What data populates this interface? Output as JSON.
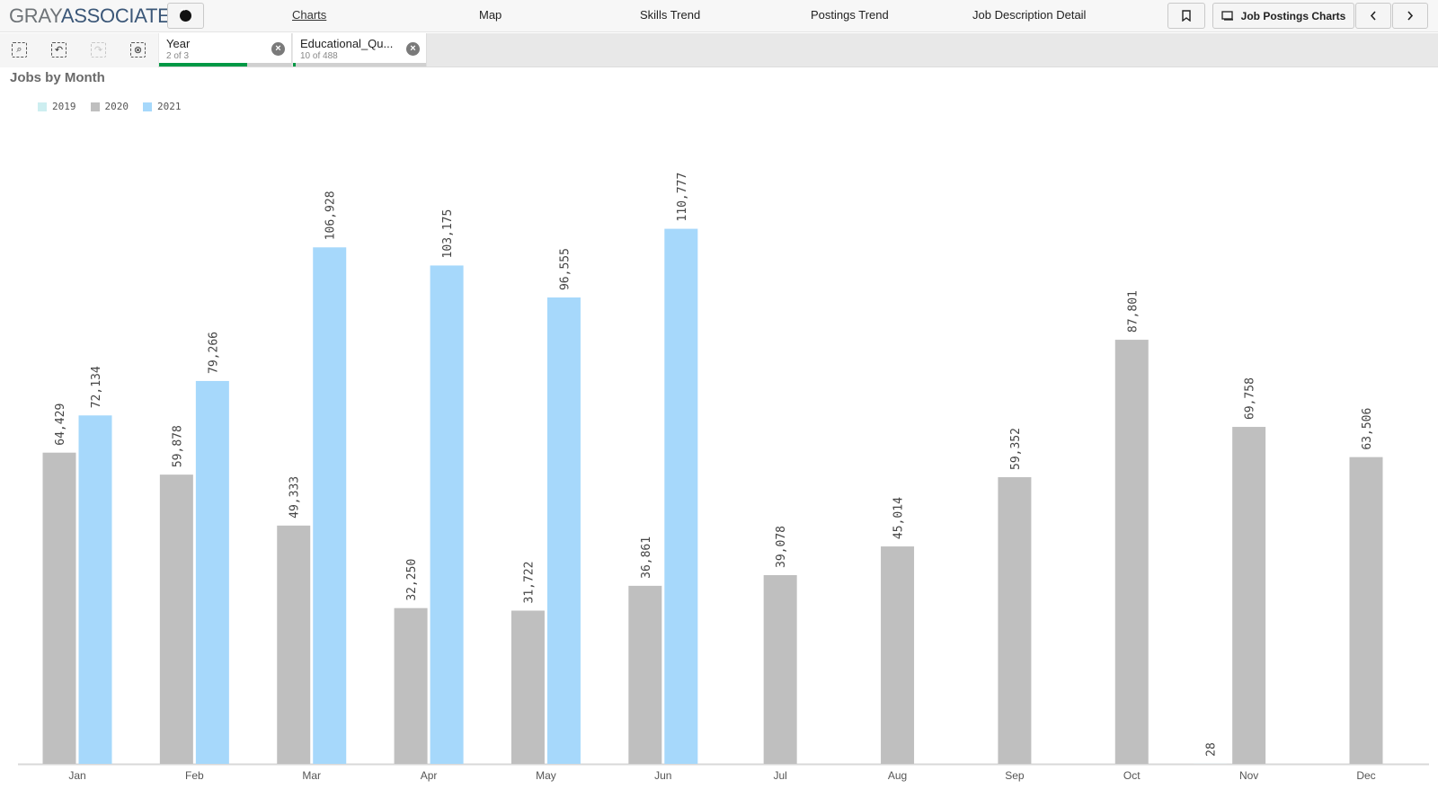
{
  "header": {
    "logo_part1": "GRAY",
    "logo_part2": "ASSOCIATES",
    "nav": [
      {
        "label": "Charts",
        "active": true
      },
      {
        "label": "Map",
        "active": false
      },
      {
        "label": "Skills Trend",
        "active": false
      },
      {
        "label": "Postings Trend",
        "active": false
      },
      {
        "label": "Job Description Detail",
        "active": false
      }
    ],
    "sheet_button_label": "Job Postings Charts",
    "icons": {
      "menu": "more-icon",
      "bookmark": "bookmark-icon",
      "sheet": "sheet-icon",
      "prev": "chevron-left-icon",
      "next": "chevron-right-icon"
    }
  },
  "selections": {
    "tools": [
      "smart-search-icon",
      "step-back-icon",
      "step-forward-icon",
      "clear-all-icon"
    ],
    "filters": [
      {
        "title": "Year",
        "subtitle": "2 of 3",
        "progress": 0.667
      },
      {
        "title": "Educational_Qu...",
        "subtitle": "10 of 488",
        "progress": 0.02
      }
    ]
  },
  "chart_data": {
    "type": "bar",
    "title": "Jobs by Month",
    "xlabel": "",
    "ylabel": "",
    "ylim": [
      0,
      120000
    ],
    "grid": false,
    "legend_position": "top-left",
    "categories": [
      "Jan",
      "Feb",
      "Mar",
      "Apr",
      "May",
      "Jun",
      "Jul",
      "Aug",
      "Sep",
      "Oct",
      "Nov",
      "Dec"
    ],
    "series": [
      {
        "name": "2019",
        "color": "#cdeef0",
        "values": [
          null,
          null,
          null,
          null,
          null,
          null,
          null,
          null,
          null,
          null,
          28,
          null
        ],
        "labels": [
          "",
          "",
          "",
          "",
          "",
          "",
          "",
          "",
          "",
          "",
          "28",
          ""
        ]
      },
      {
        "name": "2020",
        "color": "#bfbfbf",
        "values": [
          64429,
          59878,
          49333,
          32250,
          31722,
          36861,
          39078,
          45014,
          59352,
          87801,
          69758,
          63506
        ],
        "labels": [
          "64,429",
          "59,878",
          "49,333",
          "32,250",
          "31,722",
          "36,861",
          "39,078",
          "45,014",
          "59,352",
          "87,801",
          "69,758",
          "63,506"
        ]
      },
      {
        "name": "2021",
        "color": "#a6d8fb",
        "values": [
          72134,
          79266,
          106928,
          103175,
          96555,
          110777,
          null,
          null,
          null,
          null,
          null,
          null
        ],
        "labels": [
          "72,134",
          "79,266",
          "106,928",
          "103,175",
          "96,555",
          "110,777",
          "",
          "",
          "",
          "",
          "",
          ""
        ]
      }
    ]
  }
}
